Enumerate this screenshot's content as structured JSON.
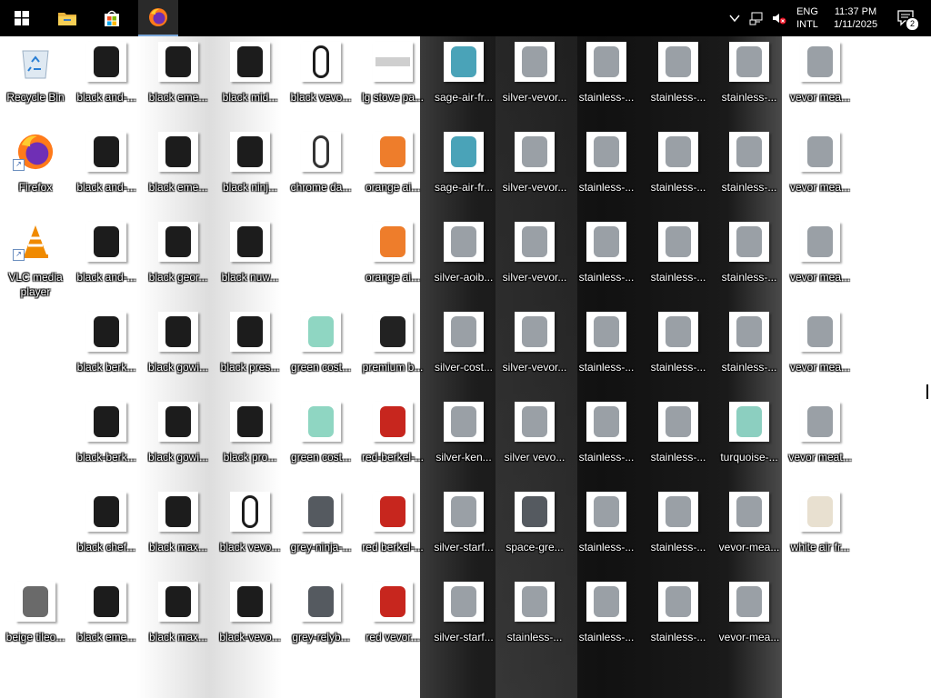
{
  "taskbar": {
    "buttons": [
      {
        "name": "start-button",
        "icon": "windows-logo-icon"
      },
      {
        "name": "file-explorer-button",
        "icon": "folder-icon"
      },
      {
        "name": "microsoft-store-button",
        "icon": "store-icon"
      },
      {
        "name": "firefox-taskbar-button",
        "icon": "firefox-icon"
      }
    ],
    "tray": {
      "language_line1": "ENG",
      "language_line2": "INTL",
      "time": "11:37 PM",
      "date": "1/11/2025",
      "notification_count": "2"
    }
  },
  "desktop": {
    "columns": [
      [
        "Recycle Bin",
        "Firefox",
        "VLC media player",
        "",
        "",
        "",
        "beige tileo..."
      ],
      [
        "black and-...",
        "black and-...",
        "black and-...",
        "black berk...",
        "black-berk...",
        "black chef...",
        "black eme..."
      ],
      [
        "black eme...",
        "black eme...",
        "black geor...",
        "black gowi...",
        "black gowi...",
        "black max...",
        "black max..."
      ],
      [
        "black mid...",
        "black ninj...",
        "black nuw...",
        "black pres...",
        "black pro...",
        "black vevo...",
        "black-vevo..."
      ],
      [
        "black vevo...",
        "chrome da...",
        "",
        "green cost...",
        "green cost...",
        "grey-ninja-...",
        "grey-relyb..."
      ],
      [
        "lg stove pa...",
        "orange ai...",
        "orange ai...",
        "premium b...",
        "red-berkel-...",
        "red berkel-...",
        "red vevor..."
      ],
      [
        "sage-air-fr...",
        "sage-air-fr...",
        "silver-aoib...",
        "silver-cost...",
        "silver-ken...",
        "silver-starf...",
        "silver-starf..."
      ],
      [
        "silver-vevor...",
        "silver-vevor...",
        "silver-vevor...",
        "silver-vevor...",
        "silver vevo...",
        "space-gre...",
        "stainless-..."
      ],
      [
        "stainless-...",
        "stainless-...",
        "stainless-...",
        "stainless-...",
        "stainless-...",
        "stainless-...",
        "stainless-..."
      ],
      [
        "stainless-...",
        "stainless-...",
        "stainless-...",
        "stainless-...",
        "stainless-...",
        "stainless-...",
        "stainless-..."
      ],
      [
        "stainless-...",
        "stainless-...",
        "stainless-...",
        "stainless-...",
        "turquoise-...",
        "vevor-mea...",
        "vevor-mea..."
      ],
      [
        "vevor mea...",
        "vevor mea...",
        "vevor mea...",
        "vevor mea...",
        "vevor meat...",
        "white air fr...",
        ""
      ]
    ]
  }
}
